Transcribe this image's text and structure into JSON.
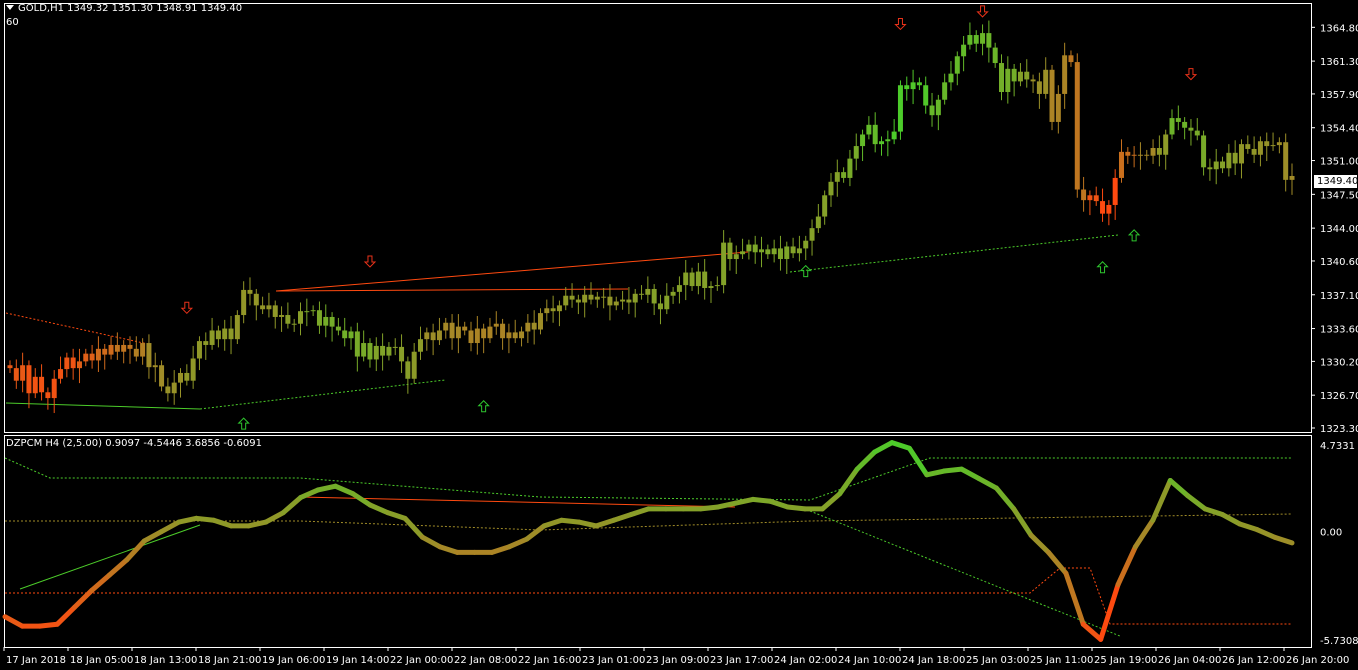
{
  "header": {
    "symbol_line": "GOLD,H1  1349.32 1351.30 1348.91 1349.40",
    "period_value": "60"
  },
  "indicator": {
    "label": "DZPCM H4 (2,5.00) 0.9097 -4.5446 3.6856 -0.6091",
    "axis_labels": [
      "4.7331",
      "0.00",
      "-5.7308"
    ]
  },
  "price_axis_labels": [
    "1364.80",
    "1361.30",
    "1357.90",
    "1354.40",
    "1351.00",
    "1347.50",
    "1344.00",
    "1340.60",
    "1337.10",
    "1333.60",
    "1330.20",
    "1326.70",
    "1323.30"
  ],
  "current_price": "1349.40",
  "time_labels": [
    "17 Jan 2018",
    "18 Jan 05:00",
    "18 Jan 13:00",
    "18 Jan 21:00",
    "19 Jan 06:00",
    "19 Jan 14:00",
    "22 Jan 00:00",
    "22 Jan 08:00",
    "22 Jan 16:00",
    "23 Jan 01:00",
    "23 Jan 09:00",
    "23 Jan 17:00",
    "24 Jan 02:00",
    "24 Jan 10:00",
    "24 Jan 18:00",
    "25 Jan 03:00",
    "25 Jan 11:00",
    "25 Jan 19:00",
    "26 Jan 04:00",
    "26 Jan 12:00",
    "26 Jan 20:00"
  ],
  "colors": {
    "bull": "#4ccc2a",
    "mid": "#a08c28",
    "bear": "#ff4a10",
    "down_arrow": "#e8321a",
    "up_arrow": "#2ec42e",
    "grid": "#fff"
  },
  "chart_data": {
    "type": "candlestick",
    "closes": [
      1329.5,
      1328.2,
      1329.8,
      1326.9,
      1328.6,
      1327.0,
      1326.4,
      1328.4,
      1329.4,
      1330.6,
      1329.5,
      1330.2,
      1331.0,
      1330.3,
      1331.5,
      1330.9,
      1331.9,
      1331.2,
      1331.9,
      1331.5,
      1330.7,
      1332.1,
      1329.6,
      1329.8,
      1327.6,
      1326.9,
      1328.0,
      1329.0,
      1328.2,
      1330.5,
      1332.3,
      1331.9,
      1333.4,
      1332.5,
      1333.6,
      1332.5,
      1335.0,
      1337.6,
      1337.2,
      1336.0,
      1335.6,
      1336.0,
      1334.8,
      1335.0,
      1334.1,
      1334.1,
      1335.4,
      1335.4,
      1335.5,
      1333.9,
      1334.8,
      1333.8,
      1333.4,
      1332.6,
      1333.3,
      1330.7,
      1332.1,
      1330.4,
      1331.8,
      1330.8,
      1331.7,
      1331.7,
      1330.2,
      1328.4,
      1331.2,
      1332.5,
      1333.2,
      1332.4,
      1333.4,
      1334.2,
      1332.6,
      1333.8,
      1333.4,
      1332.1,
      1333.6,
      1332.6,
      1333.8,
      1334.1,
      1332.6,
      1333.2,
      1332.6,
      1333.3,
      1334.2,
      1333.5,
      1335.2,
      1335.7,
      1335.4,
      1336.0,
      1337.0,
      1336.6,
      1336.3,
      1337.1,
      1336.6,
      1336.9,
      1336.9,
      1336.0,
      1336.4,
      1336.6,
      1336.3,
      1337.2,
      1337.1,
      1337.7,
      1336.2,
      1335.6,
      1337.0,
      1337.4,
      1338.1,
      1339.4,
      1338.0,
      1339.5,
      1337.8,
      1338.0,
      1338.1,
      1342.5,
      1340.8,
      1341.3,
      1341.6,
      1342.3,
      1341.5,
      1341.8,
      1341.3,
      1341.9,
      1340.8,
      1342.1,
      1341.4,
      1341.9,
      1342.7,
      1344.0,
      1345.2,
      1347.4,
      1348.8,
      1349.8,
      1349.2,
      1351.2,
      1352.5,
      1353.7,
      1354.7,
      1352.7,
      1353.0,
      1353.2,
      1354.0,
      1358.8,
      1358.4,
      1359.1,
      1358.8,
      1356.7,
      1355.7,
      1357.3,
      1359.1,
      1360.0,
      1361.8,
      1363.0,
      1364.0,
      1363.1,
      1364.2,
      1362.7,
      1361.1,
      1358.1,
      1360.5,
      1359.2,
      1360.2,
      1359.4,
      1359.2,
      1357.9,
      1360.4,
      1355.0,
      1357.9,
      1361.9,
      1361.2,
      1348.0,
      1346.9,
      1347.4,
      1346.8,
      1345.5,
      1346.4,
      1349.2,
      1351.9,
      1351.5,
      1351.6,
      1351.6,
      1351.5,
      1352.3,
      1351.6,
      1353.7,
      1355.4,
      1355.0,
      1354.4,
      1354.1,
      1353.6,
      1350.3,
      1350.1,
      1350.9,
      1350.2,
      1351.8,
      1350.7,
      1352.7,
      1352.2,
      1351.6,
      1353.0,
      1352.5,
      1352.6,
      1352.9,
      1349.0,
      1349.4
    ],
    "up_arrows": [
      [
        37,
        1323.7
      ],
      [
        75,
        1325.5
      ],
      [
        126,
        1339.5
      ],
      [
        173,
        1339.9
      ],
      [
        178,
        1343.2
      ]
    ],
    "down_arrows": [
      [
        28,
        1335.8
      ],
      [
        57,
        1340.6
      ],
      [
        141,
        1365.2
      ],
      [
        154,
        1366.5
      ],
      [
        187,
        1360.0
      ]
    ],
    "indicator_values": [
      -4.5,
      -5.0,
      -5.0,
      -4.9,
      -4.0,
      -3.1,
      -2.3,
      -1.5,
      -0.5,
      0.0,
      0.5,
      0.7,
      0.6,
      0.3,
      0.3,
      0.5,
      1.0,
      1.8,
      2.2,
      2.4,
      2.0,
      1.4,
      1.0,
      0.7,
      -0.3,
      -0.8,
      -1.1,
      -1.1,
      -1.1,
      -0.8,
      -0.4,
      0.3,
      0.6,
      0.5,
      0.3,
      0.6,
      0.9,
      1.2,
      1.2,
      1.2,
      1.2,
      1.3,
      1.5,
      1.7,
      1.6,
      1.3,
      1.2,
      1.2,
      2.0,
      3.3,
      4.2,
      4.7,
      4.4,
      3.0,
      3.2,
      3.3,
      2.8,
      2.3,
      1.2,
      -0.2,
      -1.1,
      -2.2,
      -4.9,
      -5.7,
      -2.8,
      -0.8,
      0.6,
      2.7,
      1.9,
      1.2,
      0.9,
      0.4,
      0.1,
      -0.3,
      -0.6
    ],
    "indicator_range": [
      -5.7308,
      4.7331
    ],
    "price_range": [
      1323.3,
      1366.8
    ]
  }
}
